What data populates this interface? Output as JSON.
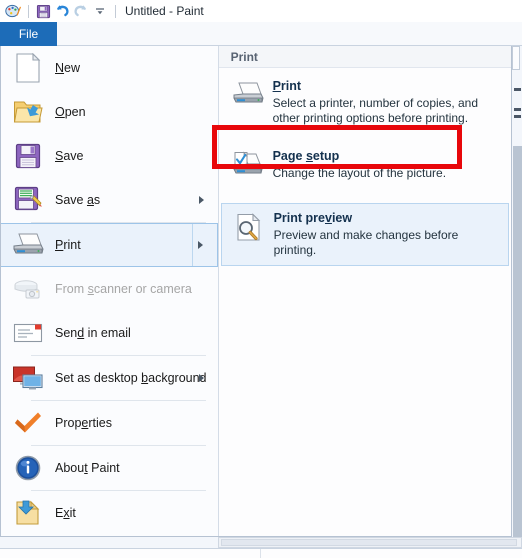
{
  "window": {
    "title": "Untitled - Paint",
    "quick_access": [
      {
        "name": "paint-app-icon",
        "glyph": "palette"
      },
      {
        "name": "save-icon",
        "glyph": "floppy"
      },
      {
        "name": "undo-icon",
        "glyph": "undo"
      },
      {
        "name": "redo-icon",
        "glyph": "redo"
      },
      {
        "name": "customize-quick-access-toolbar-icon",
        "glyph": "chevron-down"
      }
    ]
  },
  "tabs": {
    "file_label": "File"
  },
  "file_menu": {
    "items": [
      {
        "label": "New",
        "accel_index": 1,
        "icon": "new-page-icon",
        "has_submenu": false,
        "disabled": false,
        "selected": false
      },
      {
        "label": "Open",
        "accel_index": 1,
        "icon": "open-folder-icon",
        "has_submenu": false,
        "disabled": false,
        "selected": false
      },
      {
        "label": "Save",
        "accel_index": 1,
        "icon": "save-floppy-icon",
        "has_submenu": false,
        "disabled": false,
        "selected": false
      },
      {
        "label": "Save as",
        "accel_index": 5,
        "icon": "save-as-floppy-icon",
        "has_submenu": true,
        "disabled": false,
        "selected": false
      },
      {
        "label": "Print",
        "accel_index": 1,
        "icon": "printer-icon",
        "has_submenu": true,
        "disabled": false,
        "selected": true
      },
      {
        "label": "From scanner or camera",
        "accel_index": 6,
        "icon": "scanner-camera-icon",
        "has_submenu": false,
        "disabled": true,
        "selected": false
      },
      {
        "label": "Send in email",
        "accel_index": 4,
        "icon": "email-envelope-icon",
        "has_submenu": false,
        "disabled": false,
        "selected": false
      },
      {
        "label": "Set as desktop background",
        "accel_index": 14,
        "icon": "desktop-monitor-icon",
        "has_submenu": true,
        "disabled": false,
        "selected": false
      },
      {
        "label": "Properties",
        "accel_index": 5,
        "icon": "properties-checkmark-icon",
        "has_submenu": false,
        "disabled": false,
        "selected": false
      },
      {
        "label": "About Paint",
        "accel_index": 5,
        "icon": "about-info-icon",
        "has_submenu": false,
        "disabled": false,
        "selected": false
      },
      {
        "label": "Exit",
        "accel_index": 1,
        "icon": "exit-folder-icon",
        "has_submenu": false,
        "disabled": false,
        "selected": false
      }
    ]
  },
  "print_panel": {
    "header": "Print",
    "items": [
      {
        "title": "Print",
        "accel_index": 0,
        "description": "Select a printer, number of copies, and other printing options before printing.",
        "icon": "printer-icon",
        "hover": false,
        "annotated": false
      },
      {
        "title": "Page setup",
        "accel_index": 5,
        "description": "Change the layout of the picture.",
        "icon": "page-setup-printer-icon",
        "hover": false,
        "annotated": true
      },
      {
        "title": "Print preview",
        "accel_index": 8,
        "description": "Preview and make changes before printing.",
        "icon": "print-preview-magnifier-icon",
        "hover": true,
        "annotated": false
      }
    ]
  },
  "annotation": {
    "color": "#e8070b",
    "target": "Page setup"
  }
}
